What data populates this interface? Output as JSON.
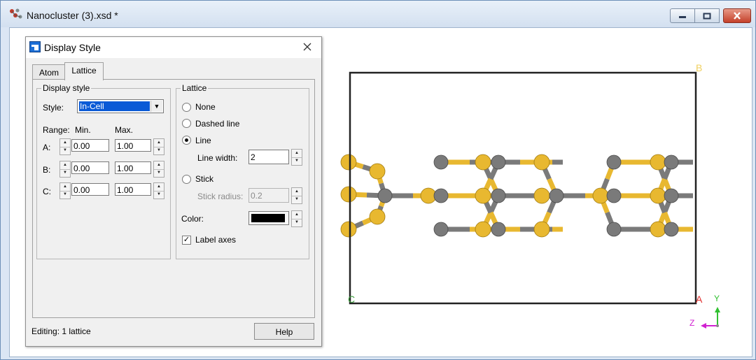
{
  "window": {
    "title": "Nanocluster (3).xsd *",
    "controls": [
      "minimize-icon",
      "maximize-icon",
      "close-icon"
    ]
  },
  "dialog": {
    "title": "Display Style",
    "tabs": [
      "Atom",
      "Lattice"
    ],
    "active_tab": "Lattice",
    "display_style": {
      "group_label": "Display style",
      "style_label": "Style:",
      "style_value": "In-Cell",
      "range_label": "Range:",
      "min_label": "Min.",
      "max_label": "Max.",
      "rows": [
        {
          "axis": "A:",
          "min": "0.00",
          "max": "1.00"
        },
        {
          "axis": "B:",
          "min": "0.00",
          "max": "1.00"
        },
        {
          "axis": "C:",
          "min": "0.00",
          "max": "1.00"
        }
      ]
    },
    "lattice": {
      "group_label": "Lattice",
      "options": [
        "None",
        "Dashed line",
        "Line",
        "Stick"
      ],
      "selected": "Line",
      "line_width_label": "Line width:",
      "line_width": "2",
      "stick_radius_label": "Stick radius:",
      "stick_radius": "0.2",
      "color_label": "Color:",
      "color": "#000000",
      "label_axes": "Label axes",
      "label_axes_checked": true
    },
    "status": "Editing: 1 lattice",
    "help_label": "Help"
  },
  "viewer": {
    "corner_labels": {
      "b": "B",
      "c": "C",
      "a": "A"
    },
    "axis_labels": {
      "y": "Y",
      "z": "Z"
    },
    "colors": {
      "sulfur": "#e8b830",
      "metal": "#7a7a7a",
      "lattice": "#222222",
      "label_a": "#e03030",
      "label_b": "#f0d060",
      "label_c": "#40a040",
      "axis_y": "#30c030",
      "axis_z": "#d020d0"
    }
  }
}
